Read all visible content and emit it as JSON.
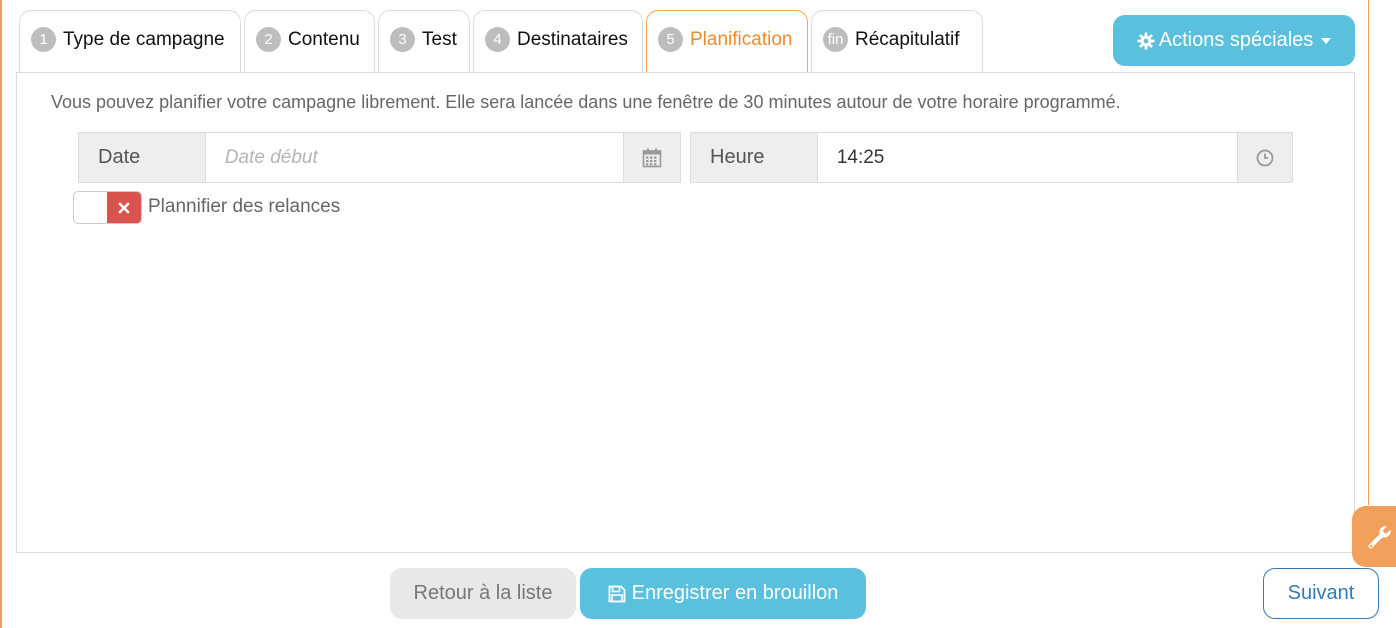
{
  "tabs": [
    {
      "num": "1",
      "label": "Type de campagne"
    },
    {
      "num": "2",
      "label": "Contenu"
    },
    {
      "num": "3",
      "label": "Test"
    },
    {
      "num": "4",
      "label": "Destinataires"
    },
    {
      "num": "5",
      "label": "Planification"
    },
    {
      "num": "fin",
      "label": "Récapitulatif"
    }
  ],
  "active_tab": "Planification",
  "actions_button": {
    "label": "Actions spéciales",
    "icon": "gear-icon"
  },
  "info_text": "Vous pouvez planifier votre campagne librement. Elle sera lancée dans une fenêtre de 30 minutes autour de votre horaire programmé.",
  "date_field": {
    "label": "Date",
    "placeholder": "Date début",
    "value": "",
    "icon": "calendar-icon"
  },
  "time_field": {
    "label": "Heure",
    "value": "14:25",
    "icon": "clock-icon"
  },
  "relances_toggle": {
    "label": "Plannifier des relances",
    "state": "off"
  },
  "buttons": {
    "back": "Retour à la liste",
    "save": "Enregistrer en brouillon",
    "next": "Suivant"
  },
  "colors": {
    "accent": "#f08a2e",
    "info": "#5bc0de",
    "danger": "#d9534f",
    "primary": "#337ab7"
  }
}
